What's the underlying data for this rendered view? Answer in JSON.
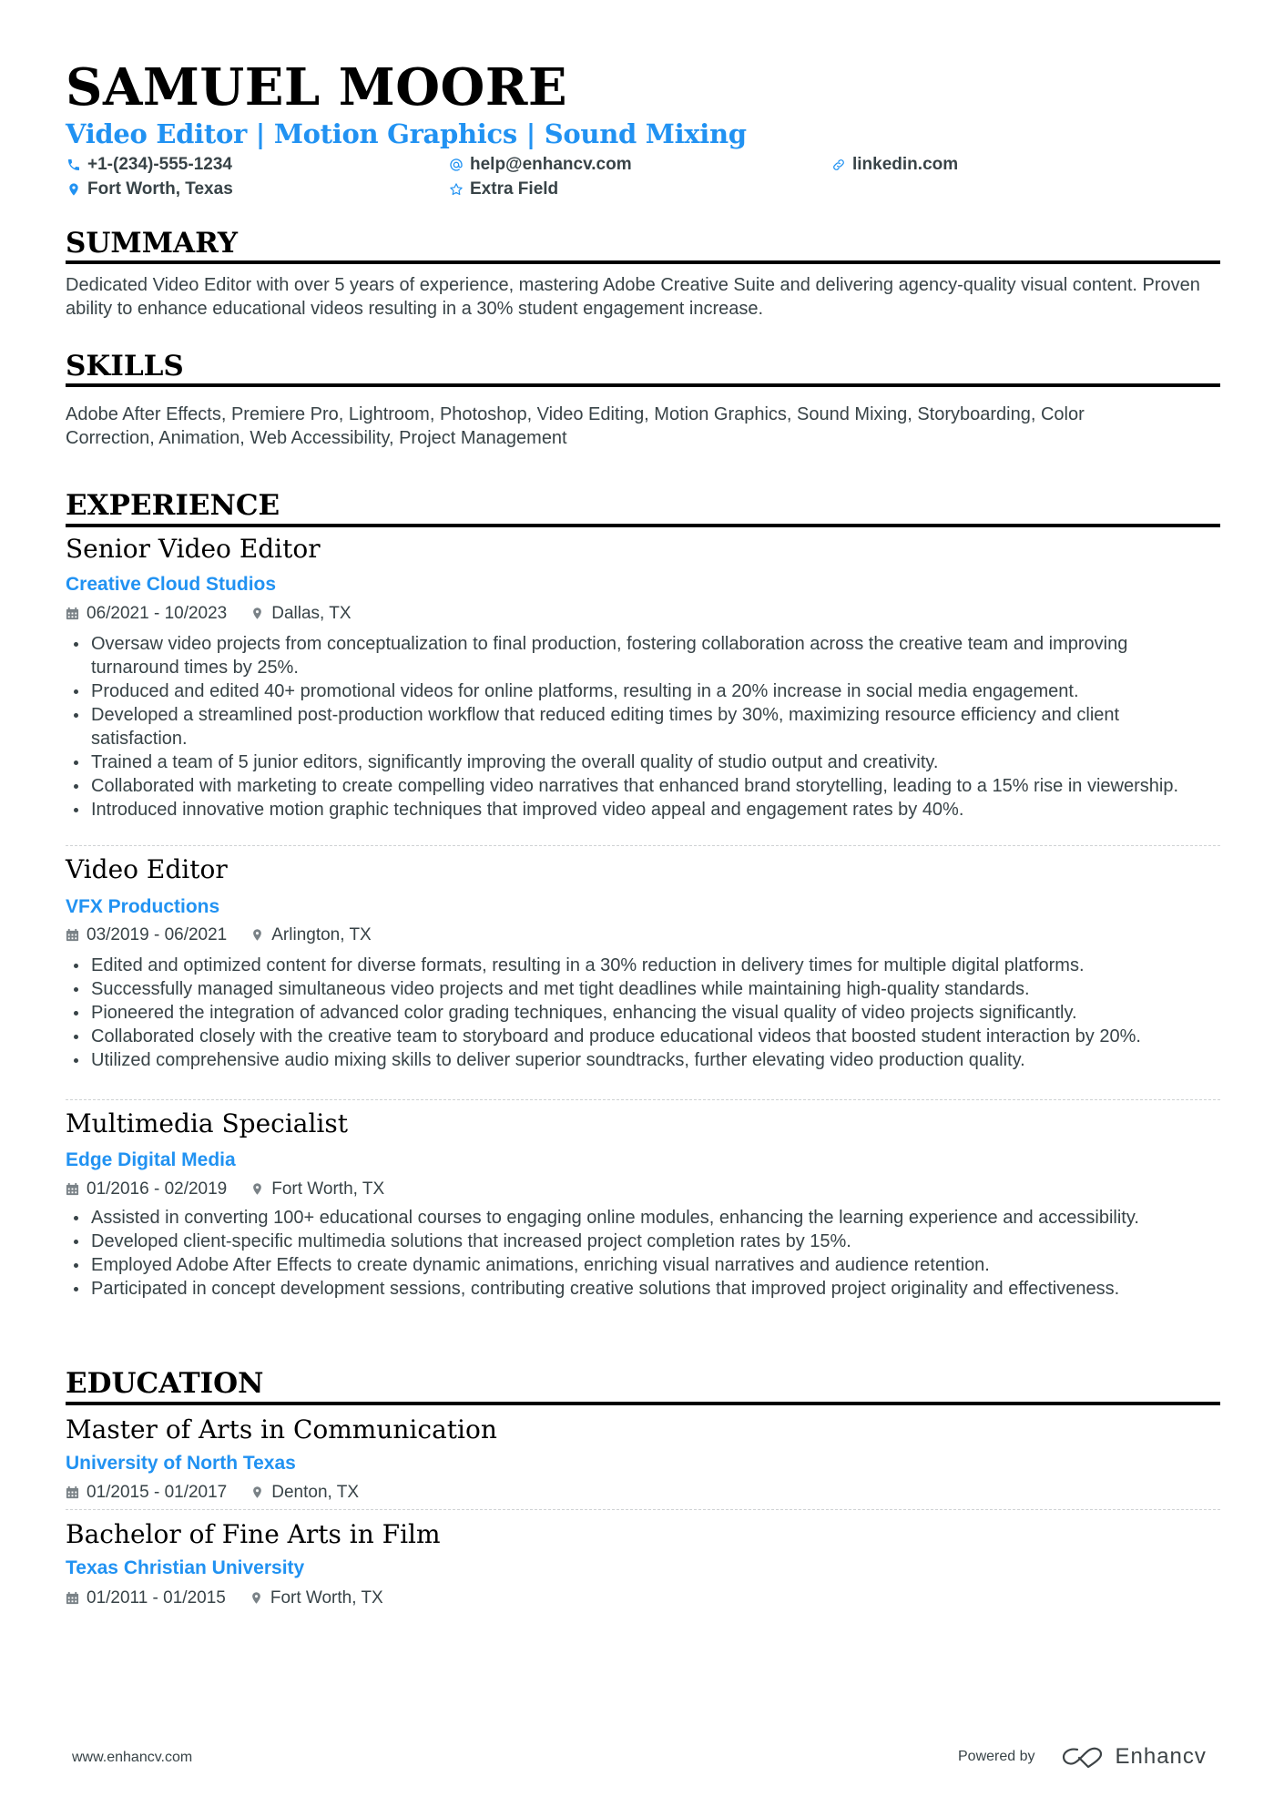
{
  "header": {
    "name": "SAMUEL MOORE",
    "title": "Video Editor | Motion Graphics | Sound Mixing",
    "contacts": [
      {
        "icon": "phone-icon",
        "text": "+1-(234)-555-1234"
      },
      {
        "icon": "at-sign-icon",
        "text": "help@enhancv.com"
      },
      {
        "icon": "link-icon",
        "text": "linkedin.com"
      },
      {
        "icon": "location-pin-icon",
        "text": "Fort Worth, Texas"
      },
      {
        "icon": "star-icon",
        "text": "Extra Field"
      }
    ]
  },
  "summary": {
    "heading": "SUMMARY",
    "text": "Dedicated Video Editor with over 5 years of experience, mastering Adobe Creative Suite and delivering agency-quality visual content. Proven ability to enhance educational videos resulting in a 30% student engagement increase."
  },
  "skills": {
    "heading": "SKILLS",
    "text": "Adobe After Effects, Premiere Pro, Lightroom, Photoshop, Video Editing, Motion Graphics, Sound Mixing, Storyboarding, Color Correction, Animation, Web Accessibility, Project Management"
  },
  "experience": {
    "heading": "EXPERIENCE",
    "items": [
      {
        "role": "Senior Video Editor",
        "company": "Creative Cloud Studios",
        "dates": "06/2021 - 10/2023",
        "location": "Dallas, TX",
        "bullets": [
          "Oversaw video projects from conceptualization to final production, fostering collaboration across the creative team and improving turnaround times by 25%.",
          "Produced and edited 40+ promotional videos for online platforms, resulting in a 20% increase in social media engagement.",
          "Developed a streamlined post-production workflow that reduced editing times by 30%, maximizing resource efficiency and client satisfaction.",
          "Trained a team of 5 junior editors, significantly improving the overall quality of studio output and creativity.",
          "Collaborated with marketing to create compelling video narratives that enhanced brand storytelling, leading to a 15% rise in viewership.",
          "Introduced innovative motion graphic techniques that improved video appeal and engagement rates by 40%."
        ]
      },
      {
        "role": "Video Editor",
        "company": "VFX Productions",
        "dates": "03/2019 - 06/2021",
        "location": "Arlington, TX",
        "bullets": [
          "Edited and optimized content for diverse formats, resulting in a 30% reduction in delivery times for multiple digital platforms.",
          "Successfully managed simultaneous video projects and met tight deadlines while maintaining high-quality standards.",
          "Pioneered the integration of advanced color grading techniques, enhancing the visual quality of video projects significantly.",
          "Collaborated closely with the creative team to storyboard and produce educational videos that boosted student interaction by 20%.",
          "Utilized comprehensive audio mixing skills to deliver superior soundtracks, further elevating video production quality."
        ]
      },
      {
        "role": "Multimedia Specialist",
        "company": "Edge Digital Media",
        "dates": "01/2016 - 02/2019",
        "location": "Fort Worth, TX",
        "bullets": [
          "Assisted in converting 100+ educational courses to engaging online modules, enhancing the learning experience and accessibility.",
          "Developed client-specific multimedia solutions that increased project completion rates by 15%.",
          "Employed Adobe After Effects to create dynamic animations, enriching visual narratives and audience retention.",
          "Participated in concept development sessions, contributing creative solutions that improved project originality and effectiveness."
        ]
      }
    ]
  },
  "education": {
    "heading": "EDUCATION",
    "items": [
      {
        "degree": "Master of Arts in Communication",
        "school": "University of North Texas",
        "dates": "01/2015 - 01/2017",
        "location": "Denton, TX"
      },
      {
        "degree": "Bachelor of Fine Arts in Film",
        "school": "Texas Christian University",
        "dates": "01/2011 - 01/2015",
        "location": "Fort Worth, TX"
      }
    ]
  },
  "footer": {
    "website": "www.enhancv.com",
    "powered_by": "Powered by",
    "brand": "Enhancv"
  },
  "colors": {
    "accent": "#2192f2",
    "text": "#384347",
    "heading": "#000000"
  }
}
